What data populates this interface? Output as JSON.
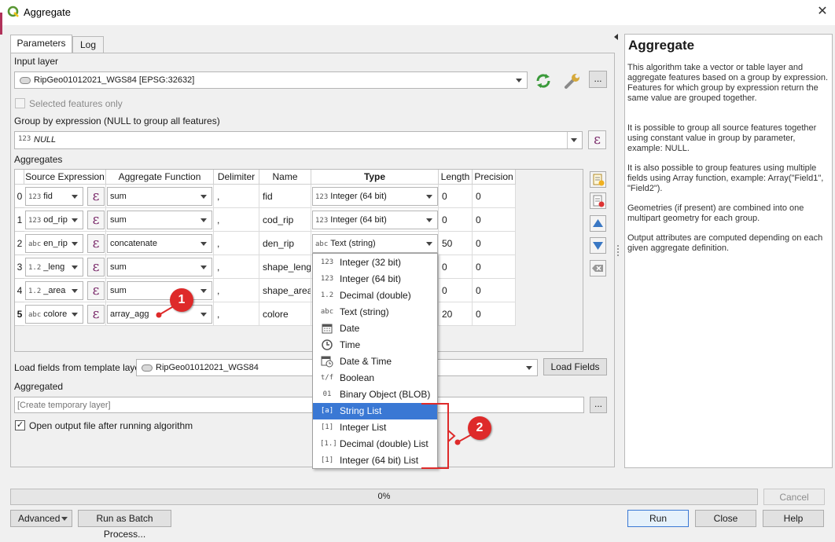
{
  "window": {
    "title": "Aggregate",
    "close_glyph": "✕"
  },
  "tabs": [
    {
      "label": "Parameters"
    },
    {
      "label": "Log"
    }
  ],
  "input_layer": {
    "label": "Input layer",
    "value": "RipGeo01012021_WGS84 [EPSG:32632]",
    "more_label": "..."
  },
  "selected_features": {
    "label": "Selected features only",
    "checked": false
  },
  "group_by": {
    "label": "Group by expression (NULL to group all features)",
    "value": "NULL",
    "type_icon": "123"
  },
  "aggregates": {
    "label": "Aggregates",
    "columns": [
      "Source Expression",
      "Aggregate Function",
      "Delimiter",
      "Name",
      "Type",
      "Length",
      "Precision"
    ],
    "rows": [
      {
        "index": "0",
        "src_icon": "123",
        "src": "fid",
        "func": "sum",
        "delim": ",",
        "name": "fid",
        "type_icon": "123",
        "type": "Integer (64 bit)",
        "length": "0",
        "precision": "0"
      },
      {
        "index": "1",
        "src_icon": "123",
        "src": "od_rip",
        "func": "sum",
        "delim": ",",
        "name": "cod_rip",
        "type_icon": "123",
        "type": "Integer (64 bit)",
        "length": "0",
        "precision": "0"
      },
      {
        "index": "2",
        "src_icon": "abc",
        "src": "en_rip",
        "func": "concatenate",
        "delim": ",",
        "name": "den_rip",
        "type_icon": "abc",
        "type": "Text (string)",
        "length": "50",
        "precision": "0"
      },
      {
        "index": "3",
        "src_icon": "1.2",
        "src": "_leng",
        "func": "sum",
        "delim": ",",
        "name": "shape_leng",
        "type_icon": "",
        "type": "",
        "length": "0",
        "precision": "0"
      },
      {
        "index": "4",
        "src_icon": "1.2",
        "src": "_area",
        "func": "sum",
        "delim": ",",
        "name": "shape_area",
        "type_icon": "",
        "type": "",
        "length": "0",
        "precision": "0"
      },
      {
        "index": "5",
        "src_icon": "abc",
        "src": "colore",
        "func": "array_agg",
        "delim": ",",
        "name": "colore",
        "type_icon": "",
        "type": "",
        "length": "20",
        "precision": "0"
      }
    ]
  },
  "type_dropdown": {
    "options": [
      {
        "icon": "123",
        "label": "Integer (32 bit)"
      },
      {
        "icon": "123",
        "label": "Integer (64 bit)"
      },
      {
        "icon": "1.2",
        "label": "Decimal (double)"
      },
      {
        "icon": "abc",
        "label": "Text (string)"
      },
      {
        "icon": "calendar-icon",
        "label": "Date"
      },
      {
        "icon": "clock-icon",
        "label": "Time"
      },
      {
        "icon": "calendar-clock-icon",
        "label": "Date & Time"
      },
      {
        "icon": "t/f",
        "label": "Boolean"
      },
      {
        "icon": "01 10",
        "label": "Binary Object (BLOB)"
      },
      {
        "icon": "[a]",
        "label": "String List"
      },
      {
        "icon": "[1]",
        "label": "Integer List"
      },
      {
        "icon": "[1.]",
        "label": "Decimal (double) List"
      },
      {
        "icon": "[1]",
        "label": "Integer (64 bit) List"
      }
    ],
    "selected": "String List"
  },
  "template_layer": {
    "label": "Load fields from template layer",
    "value": "RipGeo01012021_WGS84",
    "button": "Load Fields"
  },
  "aggregated": {
    "label": "Aggregated",
    "placeholder": "[Create temporary layer]",
    "more_label": "..."
  },
  "open_output": {
    "label": "Open output file after running algorithm",
    "checked": true
  },
  "progress": {
    "text": "0%",
    "value": 0
  },
  "buttons": {
    "cancel": "Cancel",
    "advanced": "Advanced",
    "batch": "Run as Batch Process...",
    "run": "Run",
    "close": "Close",
    "help": "Help"
  },
  "help": {
    "title": "Aggregate",
    "paragraphs": [
      "This algorithm take a vector or table layer and aggregate features based on a group by expression. Features for which group by expression return the same value are grouped together.",
      "It is possible to group all source features together using constant value in group by parameter, example: NULL.",
      "It is also possible to group features using multiple fields using Array function, example: Array(\"Field1\", \"Field2\").",
      "Geometries (if present) are combined into one multipart geometry for each group.",
      "Output attributes are computed depending on each given aggregate definition."
    ]
  },
  "annotations": [
    {
      "label": "1"
    },
    {
      "label": "2"
    }
  ],
  "colors": {
    "accent": "#3a78d4",
    "annotation": "#de2a2a",
    "epsilon": "#7a2a6a"
  }
}
